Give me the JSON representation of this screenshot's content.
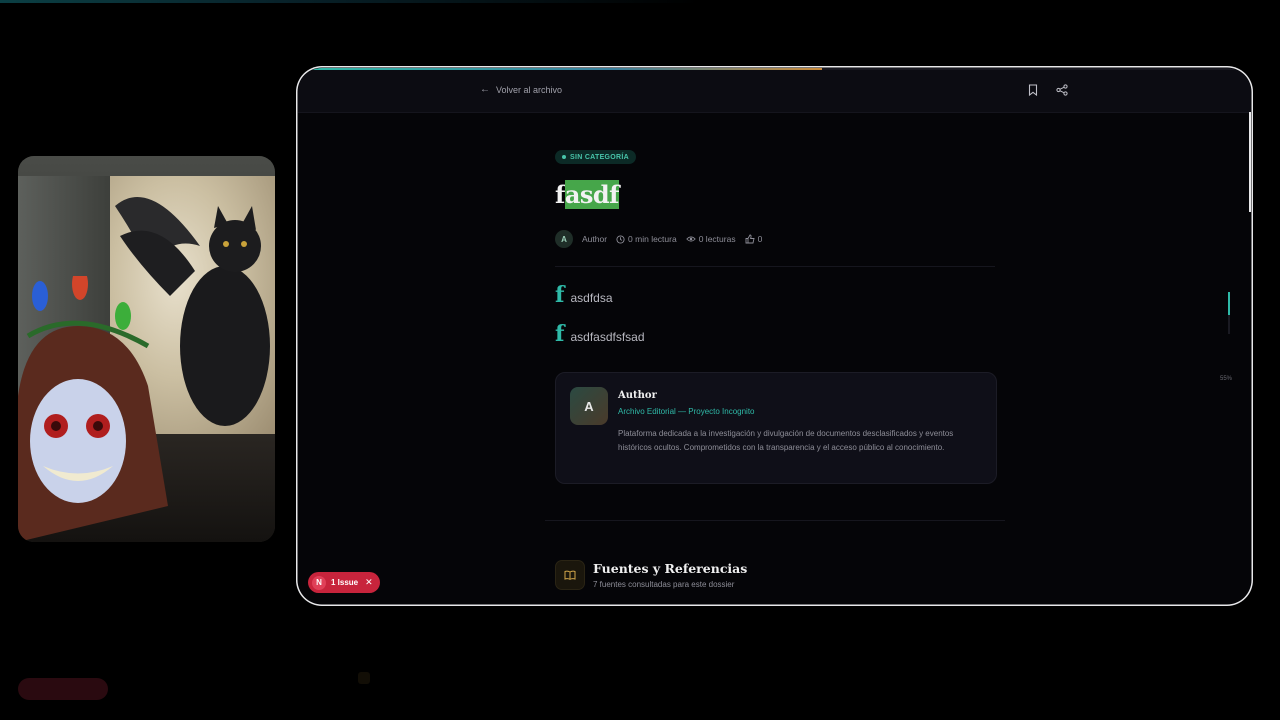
{
  "colors": {
    "accent": "#2fbaa8",
    "background": "#050508",
    "issue_red": "#c8243c",
    "selection_green": "#46a64a"
  },
  "webcam": {
    "description_icon": "webcam-overlay"
  },
  "article": {
    "back_label": "Volver al archivo",
    "category_badge": "SIN CATEGORÍA",
    "title_prefix": "f",
    "title_selected": "asdf",
    "meta": {
      "author_initial": "A",
      "author": "Author",
      "read_time": "0 min lectura",
      "reads": "0 lecturas",
      "likes": "0"
    },
    "paragraphs": [
      {
        "drop_cap": "f",
        "text": "asdfdsa"
      },
      {
        "drop_cap": "f",
        "text": "asdfasdfsfsad"
      }
    ],
    "author_card": {
      "initial": "A",
      "name": "Author",
      "org": "Archivo Editorial — Proyecto Incognito",
      "bio": "Plataforma dedicada a la investigación y divulgación de documentos desclasificados y eventos históricos ocultos. Comprometidos con la transparencia y el acceso público al conocimiento."
    },
    "sources": {
      "heading": "Fuentes y Referencias",
      "subtitle": "7 fuentes consultadas para este dossier"
    },
    "reading_progress": 0.55,
    "reading_progress_label": "55%"
  },
  "dev_overlay": {
    "badge_letter": "N",
    "issues_label": "1 Issue"
  }
}
